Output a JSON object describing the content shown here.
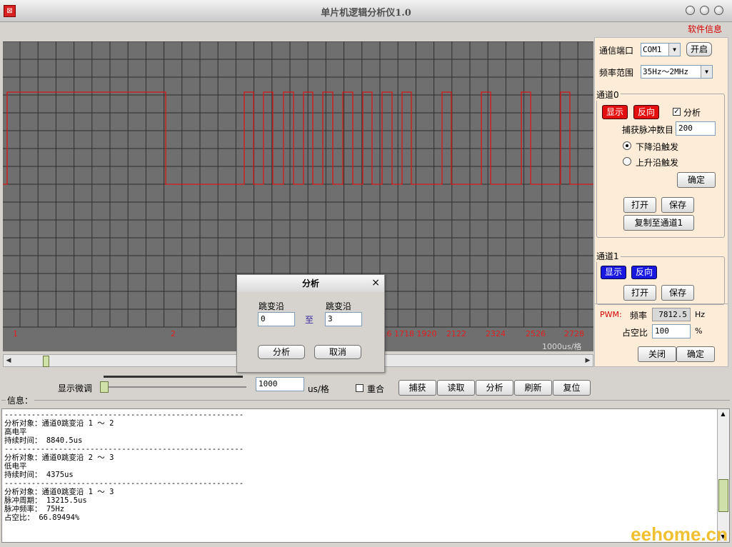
{
  "window": {
    "title": "单片机逻辑分析仪1.0"
  },
  "menu": {
    "software_info": "软件信息"
  },
  "scope": {
    "edge_labels": [
      "1",
      "2",
      "15 16 1718 1920",
      "2122",
      "2324",
      "2526",
      "2728"
    ],
    "scale_label": "1000us/格",
    "signal_color": "#d81818",
    "grid_color": "#2e2e2e",
    "background": "#6f6f6f"
  },
  "panel": {
    "port_label": "通信端口",
    "port_value": "COM1",
    "open_btn": "开启",
    "freq_label": "频率范围",
    "freq_value": "35Hz～2MHz",
    "ch0": {
      "title": "通道0",
      "show_btn": "显示",
      "invert_btn": "反向",
      "analyze_label": "分析",
      "analyze_checked": "✓",
      "pulse_label": "捕获脉冲数目",
      "pulse_value": "200",
      "falling_label": "下降沿触发",
      "rising_label": "上升沿触发",
      "ok_btn": "确定",
      "open_btn": "打开",
      "save_btn": "保存",
      "copy_btn": "复制至通道1"
    },
    "ch1": {
      "title": "通道1",
      "show_btn": "显示",
      "invert_btn": "反向",
      "open_btn": "打开",
      "save_btn": "保存"
    },
    "pwm": {
      "label": "PWM:",
      "freq_label": "频率",
      "freq_value": "7812.5",
      "freq_unit": "Hz",
      "duty_label": "占空比",
      "duty_value": "100",
      "duty_unit": "%",
      "close_btn": "关闭",
      "ok_btn": "确定"
    }
  },
  "controls": {
    "fine_label": "显示微调",
    "scale_value": "1000",
    "scale_unit": "us/格",
    "overlap_label": "重合",
    "buttons": [
      "捕获",
      "读取",
      "分析",
      "刷新",
      "复位"
    ]
  },
  "info": {
    "label": "信息：",
    "lines": [
      "-----------------------------------------------------",
      "分析对象：通道0跳变沿 1 ～ 2",
      "高电平",
      "持续时间： 8840.5us",
      "-----------------------------------------------------",
      "分析对象：通道0跳变沿 2 ～ 3",
      "低电平",
      "持续时间： 4375us",
      "-----------------------------------------------------",
      "分析对象：通道0跳变沿 1 ～ 3",
      "脉冲周期： 13215.5us",
      "脉冲频率： 75Hz",
      "占空比： 66.89494%"
    ]
  },
  "dialog": {
    "title": "分析",
    "close": "×",
    "from_label": "跳变沿",
    "to_label": "跳变沿",
    "from_value": "0",
    "to_word": "至",
    "to_value": "3",
    "analyze_btn": "分析",
    "cancel_btn": "取消"
  },
  "watermark": "eehome.cn"
}
